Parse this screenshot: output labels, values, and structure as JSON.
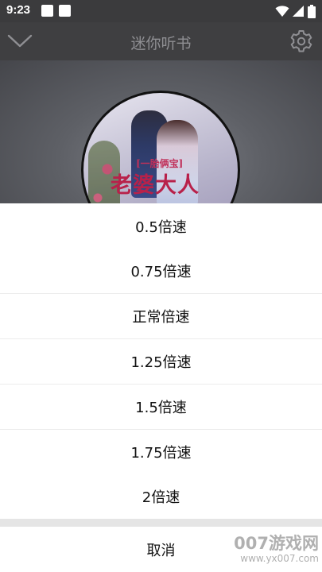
{
  "status_bar": {
    "time": "9:23",
    "icons": [
      "notification-square-icon",
      "notification-square-icon",
      "wifi-icon",
      "signal-icon",
      "battery-icon"
    ]
  },
  "app_bar": {
    "title": "迷你听书",
    "left_icon": "chevron-down-icon",
    "right_icon": "gear-icon"
  },
  "cover": {
    "tag": "[一胎俩宝]",
    "title": "老婆大人"
  },
  "speed_sheet": {
    "options": [
      {
        "label": "0.5倍速"
      },
      {
        "label": "0.75倍速"
      },
      {
        "label": "正常倍速"
      },
      {
        "label": "1.25倍速"
      },
      {
        "label": "1.5倍速"
      },
      {
        "label": "1.75倍速"
      },
      {
        "label": "2倍速"
      }
    ],
    "cancel_label": "取消"
  },
  "watermark": {
    "line1": "007游戏网",
    "line2": "www.yx007.com"
  },
  "colors": {
    "status_bar": "#3b3b3d",
    "app_bar": "#3f3f41",
    "title_text": "#8f8f93",
    "sheet_bg": "#ffffff",
    "divider": "#ececec",
    "cover_title": "#b8214a"
  }
}
